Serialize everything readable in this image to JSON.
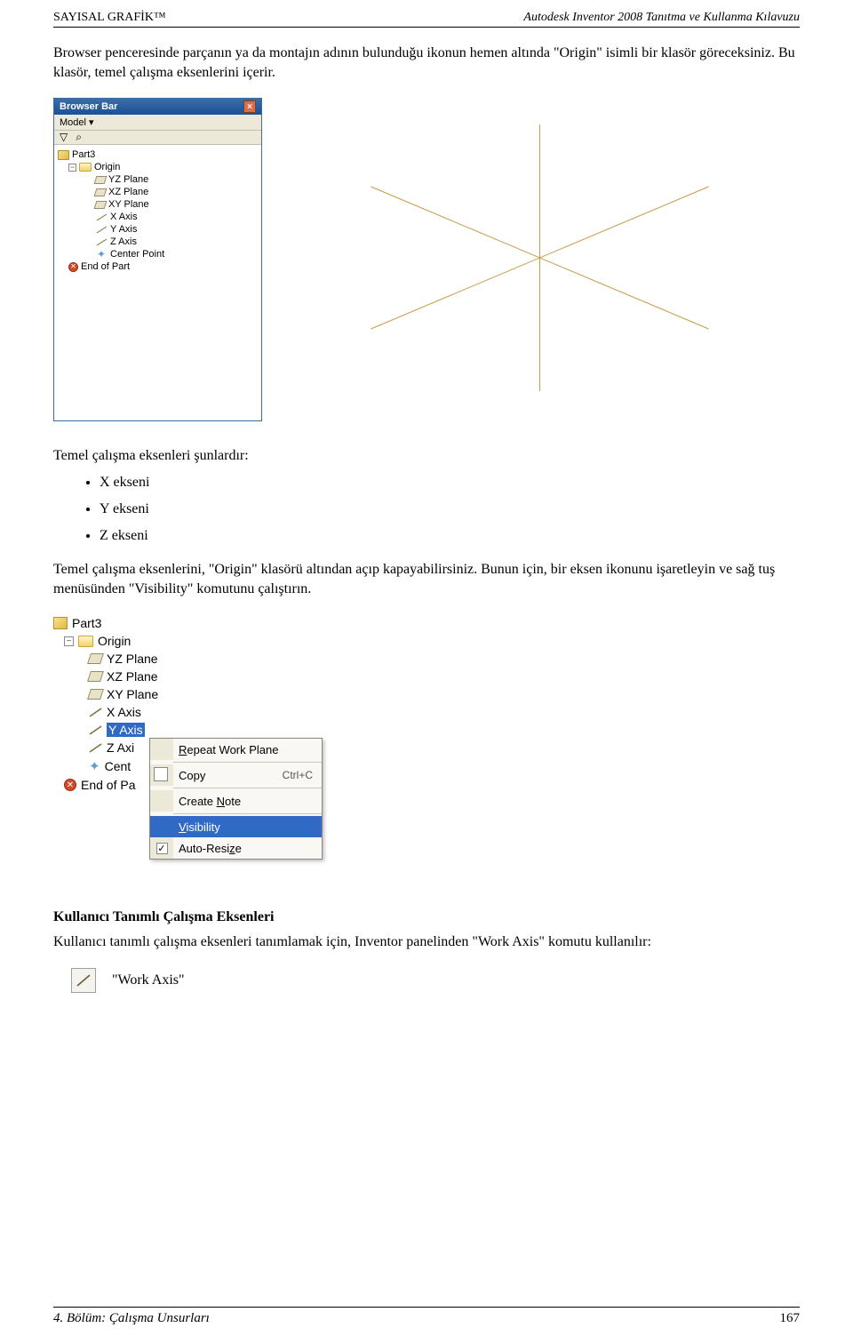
{
  "header": {
    "left": "SAYISAL GRAFİK™",
    "right": "Autodesk Inventor 2008 Tanıtma ve Kullanma Kılavuzu"
  },
  "para1": "Browser penceresinde parçanın ya da montajın adının bulunduğu ikonun hemen altında \"Origin\" isimli bir klasör göreceksiniz. Bu klasör, temel çalışma eksenlerini içerir.",
  "browser_bar": {
    "title": "Browser Bar",
    "model_label": "Model ▾",
    "toolbar_icon1": "▽",
    "toolbar_icon2": "⌕",
    "tree": {
      "part": "Part3",
      "origin": "Origin",
      "items": [
        "YZ Plane",
        "XZ Plane",
        "XY Plane",
        "X Axis",
        "Y Axis",
        "Z Axis",
        "Center Point"
      ],
      "end": "End of Part"
    }
  },
  "list_intro": "Temel çalışma eksenleri şunlardır:",
  "axes_list": [
    "X ekseni",
    "Y ekseni",
    "Z ekseni"
  ],
  "para2": "Temel çalışma eksenlerini, \"Origin\" klasörü altından açıp kapayabilirsiniz. Bunun için, bir eksen ikonunu işaretleyin ve sağ tuş menüsünden \"Visibility\" komutunu çalıştırın.",
  "tree2": {
    "part": "Part3",
    "origin": "Origin",
    "items": [
      "YZ Plane",
      "XZ Plane",
      "XY Plane",
      "X Axis",
      "Y Axis",
      "Z Axi",
      "Cent",
      "End of Pa"
    ],
    "selected": "Y Axis"
  },
  "context_menu": {
    "repeat": "Repeat Work Plane",
    "copy": "Copy",
    "copy_shortcut": "Ctrl+C",
    "create_note": "Create Note",
    "visibility": "Visibility",
    "auto_resize": "Auto-Resize"
  },
  "subhead": "Kullanıcı Tanımlı Çalışma Eksenleri",
  "para3": "Kullanıcı tanımlı çalışma eksenleri tanımlamak için, Inventor panelinden \"Work Axis\" komutu kullanılır:",
  "work_axis_label": "\"Work Axis\"",
  "footer": {
    "left": "4. Bölüm: Çalışma Unsurları",
    "page": "167"
  }
}
